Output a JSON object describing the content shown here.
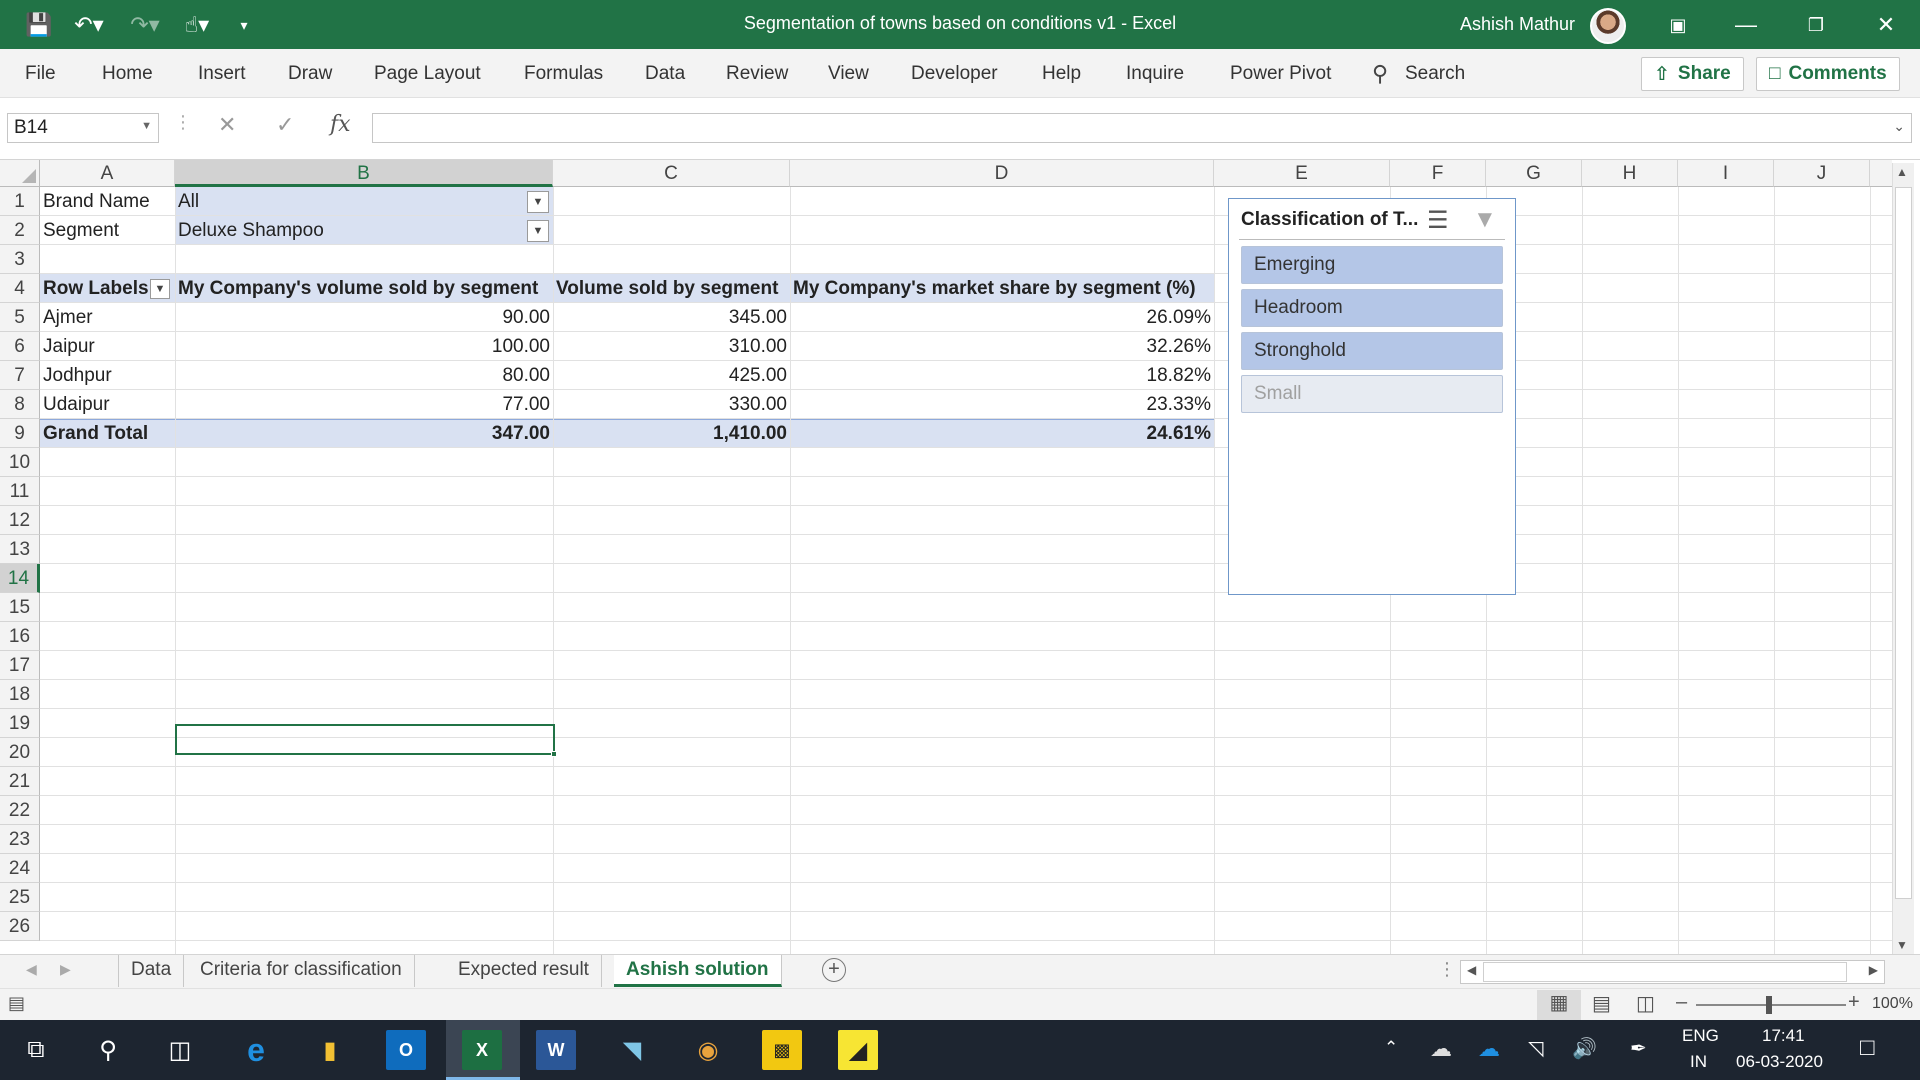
{
  "titlebar": {
    "title": "Segmentation of towns based on conditions v1  -  Excel",
    "user": "Ashish Mathur"
  },
  "ribbon": {
    "tabs": [
      "File",
      "Home",
      "Insert",
      "Draw",
      "Page Layout",
      "Formulas",
      "Data",
      "Review",
      "View",
      "Developer",
      "Help",
      "Inquire",
      "Power Pivot"
    ],
    "search_label": "Search",
    "share_label": "Share",
    "comments_label": "Comments"
  },
  "formula_bar": {
    "name_box": "B14",
    "fx_label": "fx",
    "value": ""
  },
  "columns": [
    "A",
    "B",
    "C",
    "D",
    "E",
    "F",
    "G",
    "H",
    "I",
    "J"
  ],
  "rows": [
    "1",
    "2",
    "3",
    "4",
    "5",
    "6",
    "7",
    "8",
    "9",
    "10",
    "11",
    "12",
    "13",
    "14",
    "15",
    "16",
    "17",
    "18",
    "19",
    "20",
    "21",
    "22",
    "23",
    "24",
    "25",
    "26"
  ],
  "pivot": {
    "filters": [
      {
        "label": "Brand Name",
        "value": "All"
      },
      {
        "label": "Segment",
        "value": "Deluxe Shampoo"
      }
    ],
    "headers": [
      "Row Labels",
      "My Company's volume sold by segment",
      "Volume sold by segment",
      "My Company's market share by segment (%)"
    ],
    "rows": [
      {
        "town": "Ajmer",
        "company_volume": "90.00",
        "volume": "345.00",
        "share": "26.09%"
      },
      {
        "town": "Jaipur",
        "company_volume": "100.00",
        "volume": "310.00",
        "share": "32.26%"
      },
      {
        "town": "Jodhpur",
        "company_volume": "80.00",
        "volume": "425.00",
        "share": "18.82%"
      },
      {
        "town": "Udaipur",
        "company_volume": "77.00",
        "volume": "330.00",
        "share": "23.33%"
      }
    ],
    "total": {
      "label": "Grand Total",
      "company_volume": "347.00",
      "volume": "1,410.00",
      "share": "24.61%"
    }
  },
  "slicer": {
    "title": "Classification of T...",
    "items": [
      {
        "label": "Emerging",
        "selected": true
      },
      {
        "label": "Headroom",
        "selected": true
      },
      {
        "label": "Stronghold",
        "selected": true
      },
      {
        "label": "Small",
        "selected": false
      }
    ]
  },
  "sheets": [
    "Data",
    "Criteria for classification",
    "Expected result",
    "Ashish solution"
  ],
  "active_sheet": "Ashish solution",
  "status": {
    "zoom": "100%"
  },
  "taskbar": {
    "lang_top": "ENG",
    "lang_bottom": "IN",
    "time": "17:41",
    "date": "06-03-2020"
  },
  "colors": {
    "excel_green": "#217346",
    "pivot_band": "#d9e1f2",
    "slicer_selected": "#b4c6e7"
  }
}
